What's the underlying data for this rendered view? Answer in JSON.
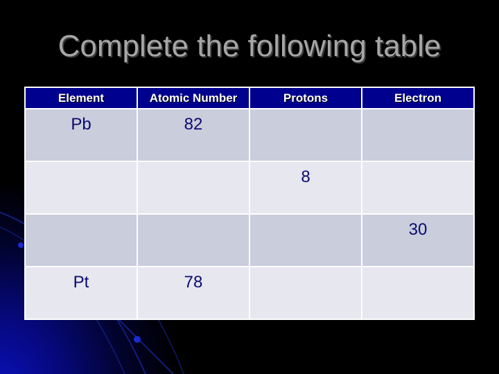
{
  "slide": {
    "title": "Complete the following table"
  },
  "table": {
    "headers": [
      "Element",
      "Atomic Number",
      "Protons",
      "Electron"
    ],
    "rows": [
      [
        "Pb",
        "82",
        "",
        ""
      ],
      [
        "",
        "",
        "8",
        ""
      ],
      [
        "",
        "",
        "",
        "30"
      ],
      [
        "Pt",
        "78",
        "",
        ""
      ]
    ]
  },
  "colors": {
    "header_bg": "#00008e",
    "row_odd_bg": "#cacddc",
    "row_even_bg": "#e6e7ef",
    "cell_text": "#0a0a6e",
    "title_text": "#a6a6a6",
    "background": "#000000"
  }
}
